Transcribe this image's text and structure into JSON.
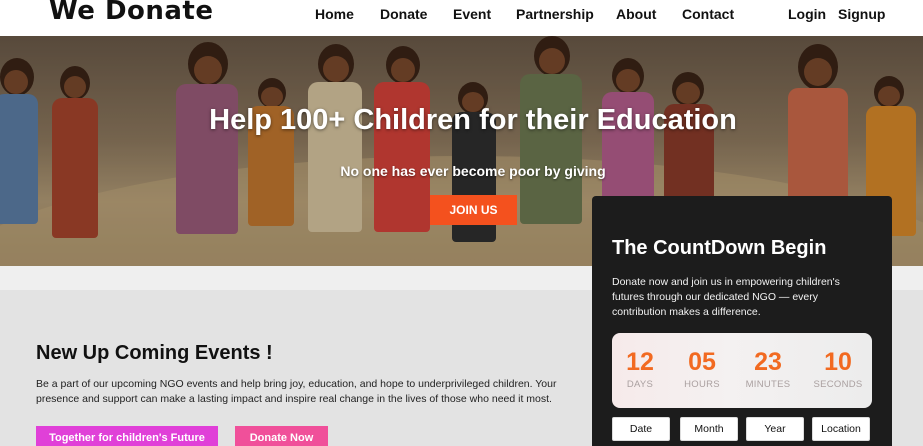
{
  "nav": {
    "logo": "We Donate",
    "links": [
      "Home",
      "Donate",
      "Event",
      "Partnership",
      "About",
      "Contact"
    ],
    "login": "Login",
    "signup": "Signup"
  },
  "hero": {
    "title": "Help 100+ Children for their Education",
    "subtitle": "No one has ever become poor by giving",
    "cta": "JOIN US"
  },
  "events": {
    "title": "New Up Coming Events !",
    "description": "Be a part of our upcoming NGO events and help bring joy, education, and hope to underprivileged children. Your presence and support can make a lasting impact and inspire real change in the lives of those who need it most.",
    "button_future": "Together for children's Future",
    "button_donate": "Donate Now"
  },
  "countdown": {
    "title": "The CountDown Begin",
    "text": "Donate now and join us in empowering children's futures through our dedicated NGO — every contribution makes a difference.",
    "units": [
      {
        "value": "12",
        "label": "DAYS"
      },
      {
        "value": "05",
        "label": "HOURS"
      },
      {
        "value": "23",
        "label": "MINUTES"
      },
      {
        "value": "10",
        "label": "SECONDS"
      }
    ],
    "buttons": [
      "Date",
      "Month",
      "Year",
      "Location"
    ]
  },
  "colors": {
    "accent": "#f4511e",
    "countdown_digits": "#f26a21",
    "pink": "#e040d8",
    "rose": "#f0509a",
    "card": "#1c1c1c"
  }
}
